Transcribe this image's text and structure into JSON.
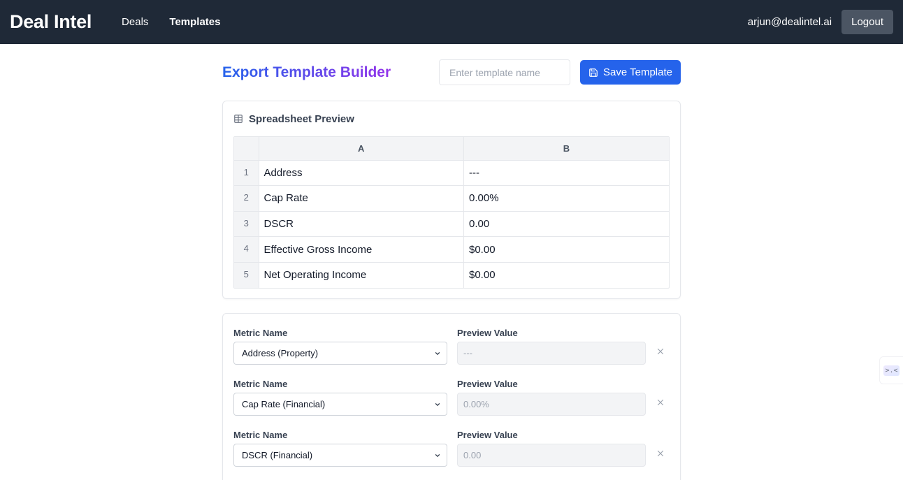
{
  "app": {
    "brand": "Deal Intel"
  },
  "nav": {
    "items": [
      {
        "label": "Deals"
      },
      {
        "label": "Templates"
      }
    ]
  },
  "user": {
    "email": "arjun@dealintel.ai",
    "logout_label": "Logout"
  },
  "page": {
    "title": "Export Template Builder",
    "template_name_placeholder": "Enter template name",
    "template_name_value": "",
    "save_label": "Save Template"
  },
  "preview": {
    "title": "Spreadsheet Preview",
    "columns": [
      "A",
      "B"
    ],
    "rows": [
      {
        "num": "1",
        "a": "Address",
        "b": "---"
      },
      {
        "num": "2",
        "a": "Cap Rate",
        "b": "0.00%"
      },
      {
        "num": "3",
        "a": "DSCR",
        "b": "0.00"
      },
      {
        "num": "4",
        "a": "Effective Gross Income",
        "b": "$0.00"
      },
      {
        "num": "5",
        "a": "Net Operating Income",
        "b": "$0.00"
      }
    ]
  },
  "metrics": {
    "name_label": "Metric Name",
    "preview_label": "Preview Value",
    "rows": [
      {
        "metric": "Address (Property)",
        "preview": "---"
      },
      {
        "metric": "Cap Rate (Financial)",
        "preview": "0.00%"
      },
      {
        "metric": "DSCR (Financial)",
        "preview": "0.00"
      }
    ]
  },
  "widget": {
    "glyph": ">.<"
  },
  "colors": {
    "nav_bg": "#1f2937",
    "primary": "#2563eb",
    "title_gradient_end": "#9333ea"
  },
  "icons": {
    "save": "save-icon",
    "table": "table-icon",
    "remove": "close-icon",
    "dropdown": "chevron-down-icon"
  }
}
